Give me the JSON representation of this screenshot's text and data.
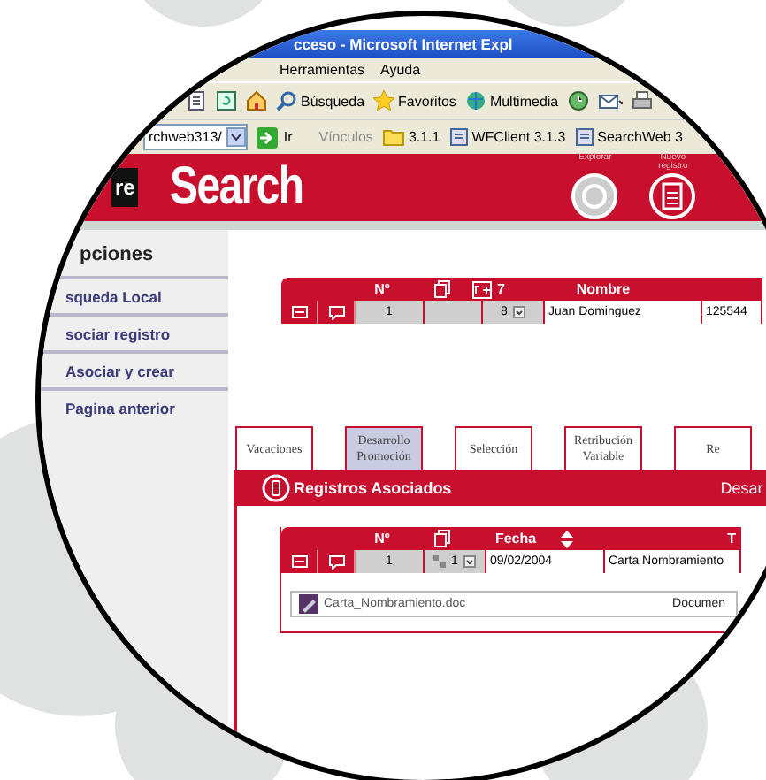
{
  "window": {
    "title": "cceso - Microsoft Internet Expl"
  },
  "menu": [
    "Herramientas",
    "Ayuda"
  ],
  "toolbar": [
    {
      "label": "Búsqueda"
    },
    {
      "label": "Favoritos"
    },
    {
      "label": "Multimedia"
    }
  ],
  "address_bar": {
    "value": "rchweb313/",
    "go_label": "Ir"
  },
  "links": {
    "label": "Vínculos",
    "items": [
      "3.1.1",
      "WFClient 3.1.3",
      "SearchWeb 3"
    ]
  },
  "header": {
    "logo_fragment": "re",
    "title": "Search",
    "actions": [
      "Explorar",
      "Nuevo registro"
    ]
  },
  "sidebar": {
    "title": "pciones",
    "items": [
      "squeda Local",
      "sociar registro",
      "Asociar y crear",
      "Pagina anterior"
    ]
  },
  "record_table": {
    "columns": [
      "Nº",
      "7",
      "Nombre"
    ],
    "row": [
      "1",
      "8",
      "Juan Dominguez",
      "125544"
    ]
  },
  "tabs": [
    {
      "label": "Vacaciones",
      "selected": false
    },
    {
      "label": "Desarrollo Promoción",
      "selected": true
    },
    {
      "label": "Selección",
      "selected": false
    },
    {
      "label": "Retribución Variable",
      "selected": false
    },
    {
      "label": "Re",
      "selected": false
    }
  ],
  "panel": {
    "title": "Registros Asociados",
    "right_text": "Desar",
    "table": {
      "columns": [
        "Nº",
        "Fecha",
        "T"
      ],
      "row": [
        "1",
        "1",
        "09/02/2004",
        "Carta Nombramiento"
      ]
    },
    "document": {
      "name": "Carta_Nombramiento.doc",
      "type": "Documen"
    }
  }
}
